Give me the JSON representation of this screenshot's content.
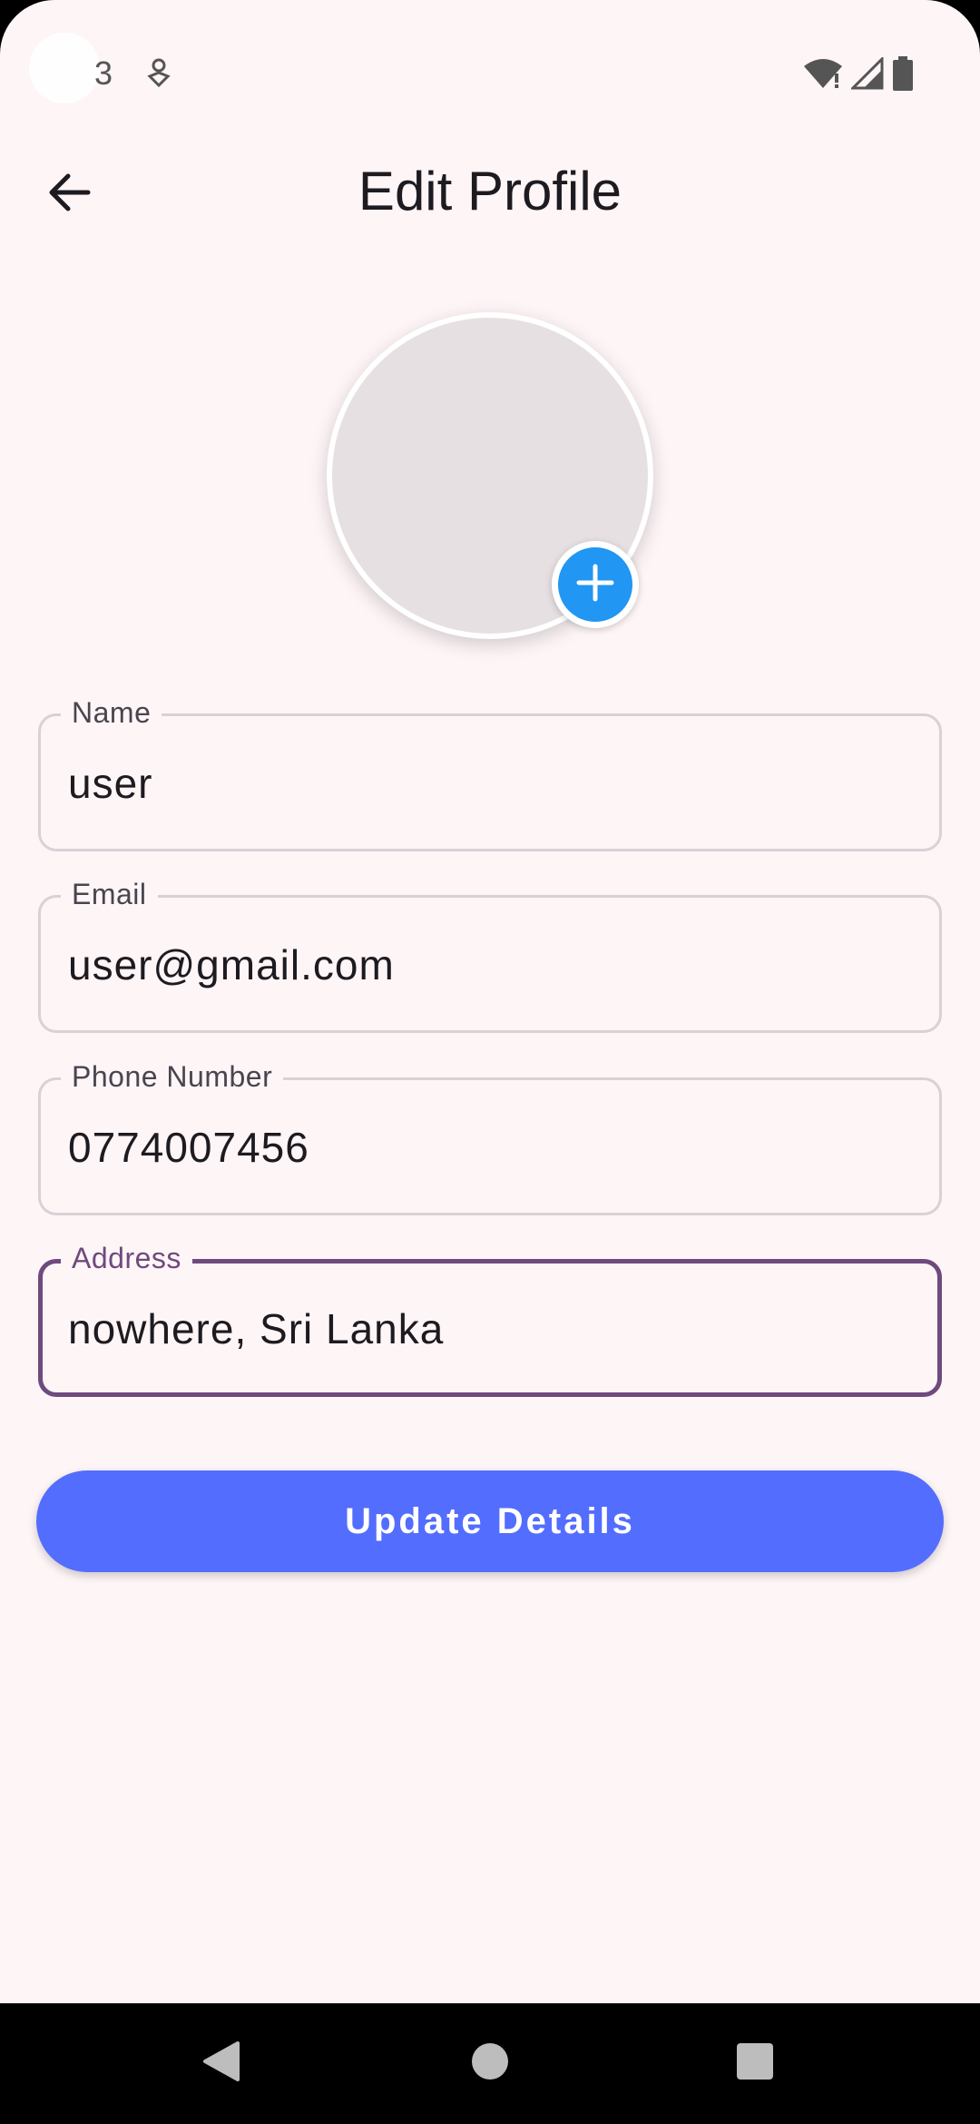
{
  "status_bar": {
    "time": "3",
    "icons": [
      "notification-icon",
      "wifi-icon",
      "signal-icon",
      "battery-icon"
    ]
  },
  "app_bar": {
    "title": "Edit Profile",
    "back_icon": "arrow-left-icon"
  },
  "avatar": {
    "add_icon": "plus-icon",
    "accent_color": "#2196f3"
  },
  "form": {
    "fields": [
      {
        "label": "Name",
        "value": "user"
      },
      {
        "label": "Email",
        "value": "user@gmail.com"
      },
      {
        "label": "Phone Number",
        "value": "0774007456"
      },
      {
        "label": "Address",
        "value": "nowhere, Sri Lanka",
        "focused": true
      }
    ],
    "focus_color": "#6f4a7e"
  },
  "update_button": {
    "label": "Update Details",
    "color": "#536dfe"
  },
  "nav_bar": {
    "icons": [
      "back-triangle-icon",
      "home-circle-icon",
      "recents-square-icon"
    ]
  }
}
